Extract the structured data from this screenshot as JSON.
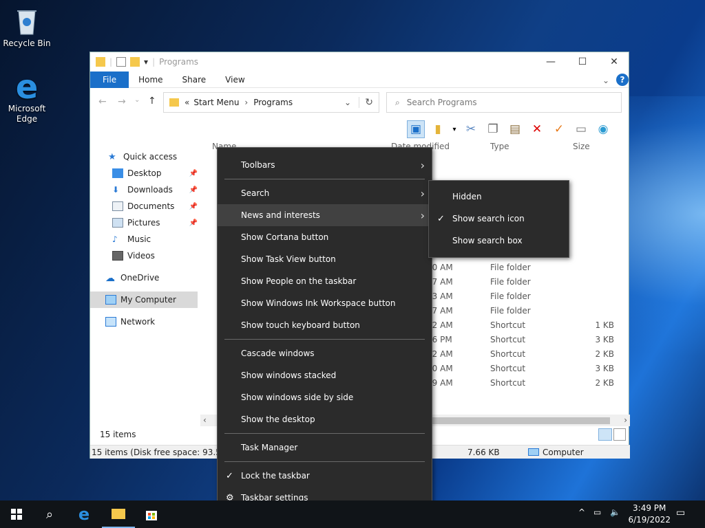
{
  "desktop": {
    "icons": [
      {
        "label": "Recycle Bin"
      },
      {
        "label": "Microsoft Edge"
      }
    ]
  },
  "window": {
    "title": "Programs",
    "ribbon_tabs": [
      "File",
      "Home",
      "Share",
      "View"
    ],
    "address": {
      "prefix": "«",
      "crumb1": "Start Menu",
      "crumb2": "Programs"
    },
    "search_placeholder": "Search Programs",
    "nav": {
      "quick_access": "Quick access",
      "desktop": "Desktop",
      "downloads": "Downloads",
      "documents": "Documents",
      "pictures": "Pictures",
      "music": "Music",
      "videos": "Videos",
      "onedrive": "OneDrive",
      "my_computer": "My Computer",
      "network": "Network"
    },
    "columns": {
      "name": "Name",
      "date": "Date modified",
      "type": "Type",
      "size": "Size"
    },
    "rows": [
      {
        "date": ":20 AM",
        "type": "File folder",
        "size": ""
      },
      {
        "date": ":57 AM",
        "type": "File folder",
        "size": ""
      },
      {
        "date": ":53 AM",
        "type": "File folder",
        "size": ""
      },
      {
        "date": ":57 AM",
        "type": "File folder",
        "size": ""
      },
      {
        "date": ":32 AM",
        "type": "Shortcut",
        "size": "1 KB"
      },
      {
        "date": ":46 PM",
        "type": "Shortcut",
        "size": "3 KB"
      },
      {
        "date": ":32 AM",
        "type": "Shortcut",
        "size": "2 KB"
      },
      {
        "date": ":10 AM",
        "type": "Shortcut",
        "size": "3 KB"
      },
      {
        "date": ":19 AM",
        "type": "Shortcut",
        "size": "2 KB"
      }
    ],
    "item_count": "15 items",
    "status_left": "15 items (Disk free space: 93.5 GB)",
    "status_size": "7.66 KB",
    "status_location": "Computer"
  },
  "context_menu": {
    "toolbars": "Toolbars",
    "search": "Search",
    "news": "News and interests",
    "cortana": "Show Cortana button",
    "taskview": "Show Task View button",
    "people": "Show People on the taskbar",
    "ink": "Show Windows Ink Workspace button",
    "touch": "Show touch keyboard button",
    "cascade": "Cascade windows",
    "stacked": "Show windows stacked",
    "side": "Show windows side by side",
    "showdesk": "Show the desktop",
    "taskmgr": "Task Manager",
    "lock": "Lock the taskbar",
    "settings": "Taskbar settings"
  },
  "submenu": {
    "hidden": "Hidden",
    "icon": "Show search icon",
    "box": "Show search box"
  },
  "clock": {
    "time": "3:49 PM",
    "date": "6/19/2022"
  },
  "colors": {
    "accent": "#1a6fc9",
    "menu_bg": "#2b2b2b",
    "taskbar": "#101418"
  }
}
